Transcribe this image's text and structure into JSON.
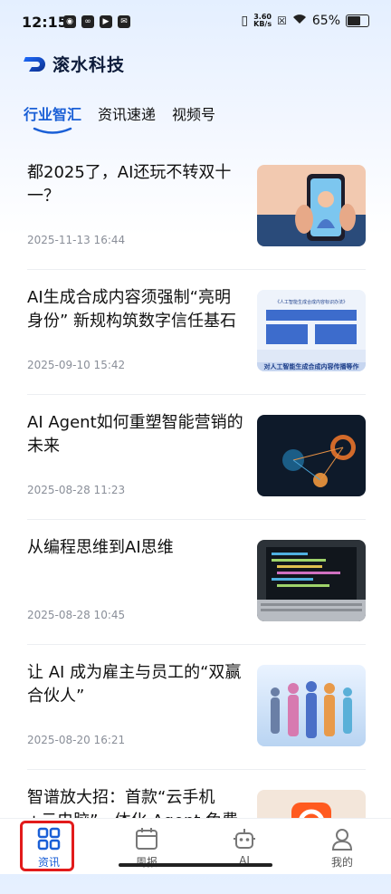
{
  "status_bar": {
    "time": "12:15",
    "speed_value": "3.60",
    "speed_unit": "KB/s",
    "battery": "65%",
    "battery_level": 0.65
  },
  "brand": {
    "name": "滚水科技"
  },
  "tabs": [
    {
      "label": "行业智汇",
      "active": true
    },
    {
      "label": "资讯速递",
      "active": false
    },
    {
      "label": "视频号",
      "active": false
    }
  ],
  "articles": [
    {
      "title": "都2025了，AI还玩不转双十一？",
      "date": "2025-11-13 16:44",
      "thumb_icon": "phone-shopping-illustration"
    },
    {
      "title": "AI生成合成内容须强制“亮明身份” 新规构筑数字信任基石",
      "date": "2025-09-10 15:42",
      "thumb_icon": "regulation-document-image",
      "thumb_text": {
        "line1": "《人工智能生成合成内容标识办法》",
        "bottom": "对人工智能生成合成内容传播等作"
      }
    },
    {
      "title": "AI Agent如何重塑智能营销的未来",
      "date": "2025-08-28 11:23",
      "thumb_icon": "digital-network-image"
    },
    {
      "title": "从编程思维到AI思维",
      "date": "2025-08-28 10:45",
      "thumb_icon": "laptop-code-image"
    },
    {
      "title": "让 AI 成为雇主与员工的“双赢合伙人”",
      "date": "2025-08-20 16:21",
      "thumb_icon": "people-silhouettes-image"
    },
    {
      "title": "智谱放大招：首款“云手机+云电脑”一体化 Agent 免费开…",
      "date": "",
      "thumb_icon": "app-logo-image"
    }
  ],
  "nav": [
    {
      "label": "资讯",
      "icon": "grid-icon",
      "active": true
    },
    {
      "label": "周报",
      "icon": "calendar-icon",
      "active": false
    },
    {
      "label": "AI",
      "icon": "robot-icon",
      "active": false
    },
    {
      "label": "我的",
      "icon": "person-icon",
      "active": false
    }
  ],
  "colors": {
    "accent": "#1a5fd6",
    "highlight": "#e21b1b"
  }
}
